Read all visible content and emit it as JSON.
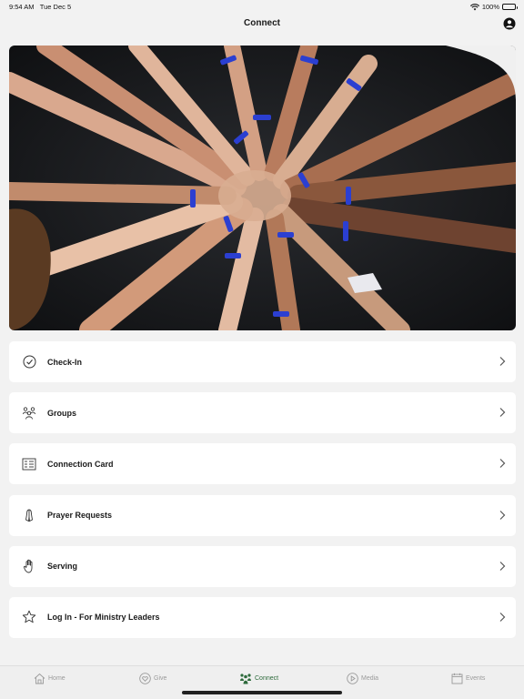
{
  "status_bar": {
    "time": "9:54 AM",
    "date": "Tue Dec 5",
    "battery": "100%"
  },
  "header": {
    "title": "Connect",
    "profile_icon": "person-circle-icon"
  },
  "hero": {
    "description_icon": "hands-together-photo"
  },
  "menu": {
    "items": [
      {
        "label": "Check-In",
        "icon": "checkmark-circle-icon"
      },
      {
        "label": "Groups",
        "icon": "group-people-icon"
      },
      {
        "label": "Connection Card",
        "icon": "card-list-icon"
      },
      {
        "label": "Prayer Requests",
        "icon": "praying-hands-icon"
      },
      {
        "label": "Serving",
        "icon": "raised-hand-icon"
      },
      {
        "label": "Log In - For Ministry Leaders",
        "icon": "star-icon"
      }
    ]
  },
  "tab_bar": {
    "tabs": [
      {
        "label": "Home",
        "icon": "house-icon",
        "active": false
      },
      {
        "label": "Give",
        "icon": "heart-circle-icon",
        "active": false
      },
      {
        "label": "Connect",
        "icon": "people-icon",
        "active": true
      },
      {
        "label": "Media",
        "icon": "play-circle-icon",
        "active": false
      },
      {
        "label": "Events",
        "icon": "calendar-icon",
        "active": false
      }
    ]
  },
  "colors": {
    "accent": "#2e6b3c",
    "background": "#f2f2f2",
    "card": "#ffffff",
    "inactive_tab": "#9a9a9a"
  }
}
